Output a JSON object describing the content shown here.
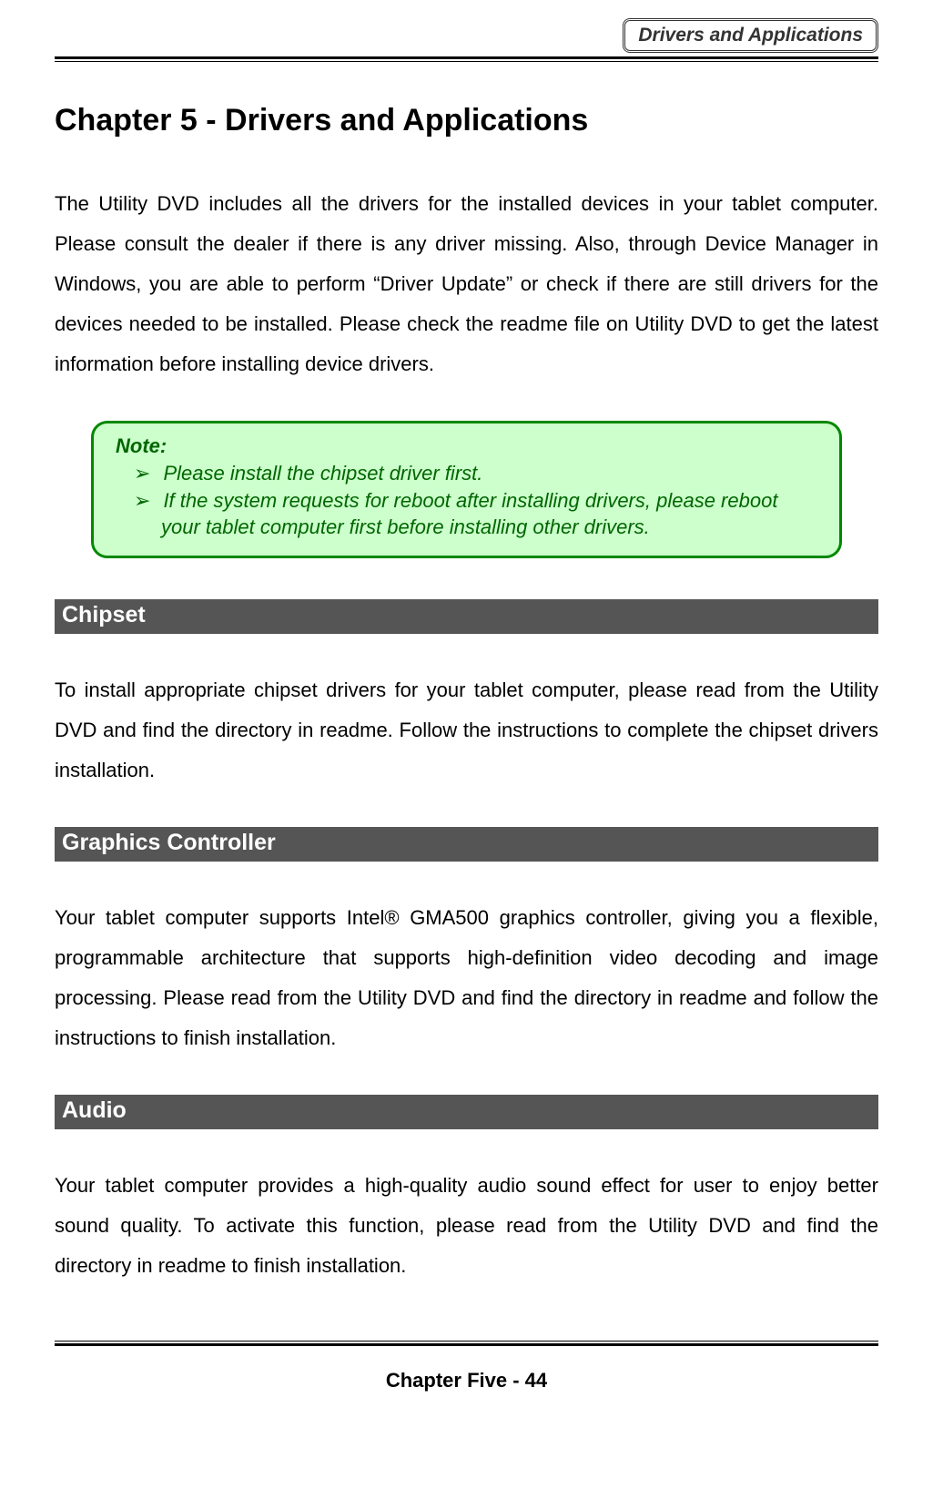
{
  "header": {
    "tag": "Drivers and Applications"
  },
  "chapter": {
    "title": "Chapter 5  - Drivers and Applications"
  },
  "intro": {
    "text": "The Utility DVD includes all the drivers for the installed devices in your tablet computer. Please consult the dealer if there is any driver missing. Also, through Device Manager in Windows, you are able to perform “Driver Update” or check if there are still drivers for the devices needed to be installed. Please check the readme file on Utility DVD to get the latest information before installing device drivers."
  },
  "note": {
    "title": "Note:",
    "items": [
      "Please install the chipset driver first.",
      "If the system requests for reboot after installing drivers, please reboot your tablet computer first before installing other drivers."
    ]
  },
  "sections": {
    "chipset": {
      "header": " Chipset",
      "body": "To install appropriate chipset drivers for your tablet computer, please read from the Utility DVD and find the directory in readme. Follow the instructions to complete the chipset drivers installation."
    },
    "graphics": {
      "header": " Graphics Controller",
      "body": "Your tablet computer supports Intel® GMA500 graphics controller, giving you a flexible, programmable architecture that supports high-definition video decoding and image processing. Please read from the Utility DVD and find the directory in readme and follow the instructions to finish installation."
    },
    "audio": {
      "header": " Audio",
      "body": "Your tablet computer provides a high-quality audio sound effect for user to enjoy better sound quality. To activate this function, please read from the Utility DVD and find the directory in readme to finish installation."
    }
  },
  "footer": {
    "text": "Chapter Five - 44"
  }
}
